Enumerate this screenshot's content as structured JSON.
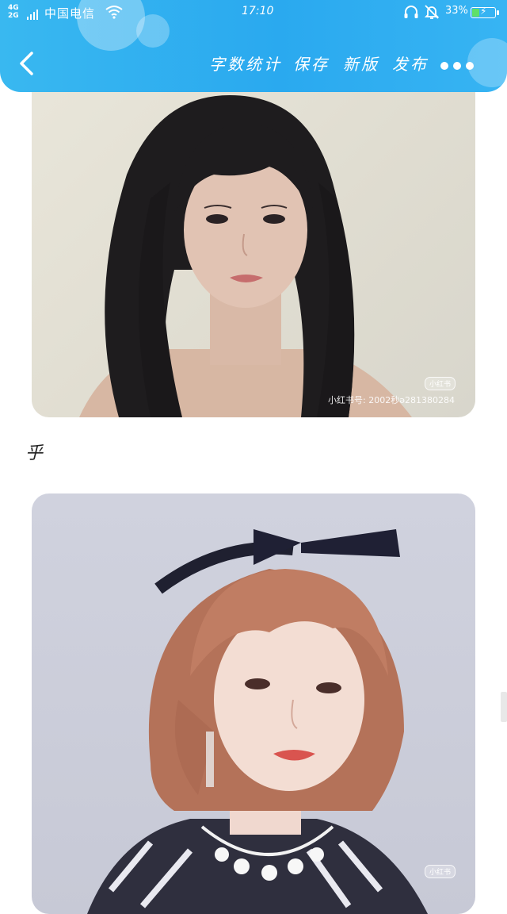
{
  "status_bar": {
    "signal_type": "4G\n2G",
    "carrier": "中国电信",
    "time": "17:10",
    "battery_percent_text": "33%",
    "battery_level": 0.33,
    "icons": [
      "signal-icon",
      "wifi-icon",
      "headset-icon",
      "mute-bell-icon",
      "battery-icon"
    ]
  },
  "toolbar": {
    "back_icon": "chevron-left-icon",
    "word_count_label": "字数统计",
    "save_label": "保存",
    "new_version_label": "新版",
    "publish_label": "发布",
    "more_icon": "more-dots-icon"
  },
  "content": {
    "photo1": {
      "watermark_badge": "小红书",
      "watermark_text": "小红书号: 2002秒ə281380284"
    },
    "caption": "乎",
    "photo2": {
      "watermark_badge": "小红书"
    }
  },
  "colors": {
    "header_gradient_start": "#39b8f0",
    "header_gradient_end": "#37b4f3",
    "battery_fill": "#5fe067"
  }
}
